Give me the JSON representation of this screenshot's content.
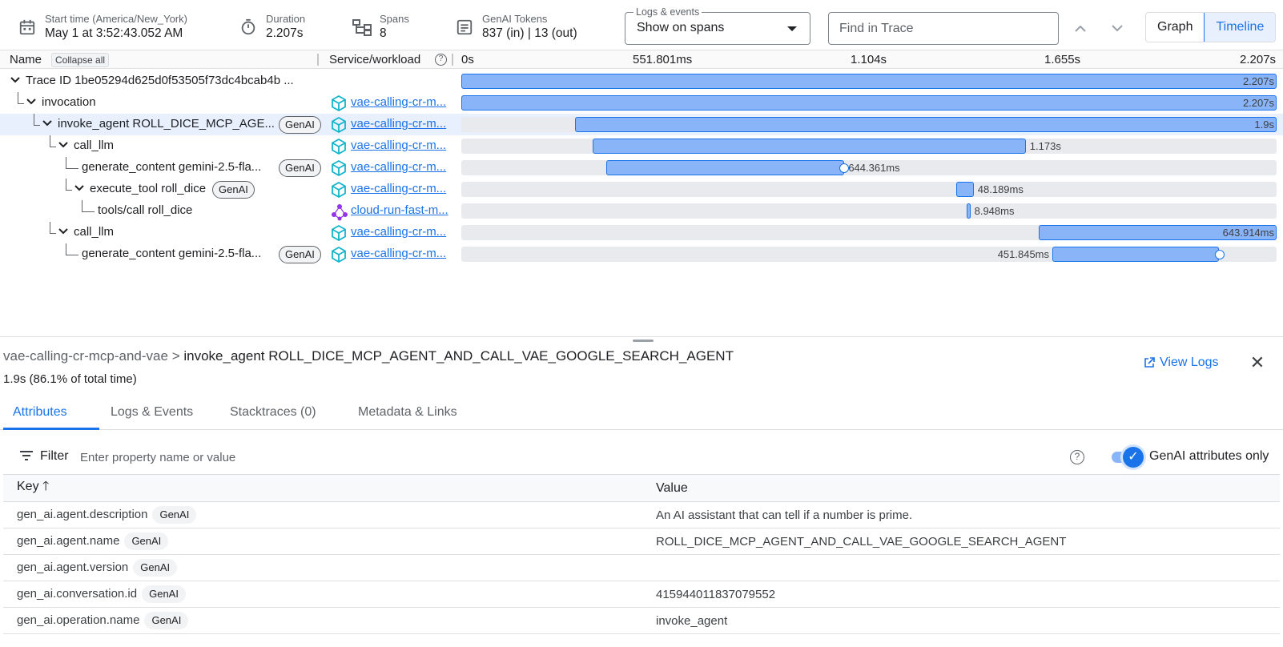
{
  "header": {
    "start_label": "Start time (America/New_York)",
    "start_value": "May 1 at 3:52:43.052 AM",
    "duration_label": "Duration",
    "duration_value": "2.207s",
    "spans_label": "Spans",
    "spans_value": "8",
    "tokens_label": "GenAI Tokens",
    "tokens_value": "837 (in) | 13 (out)",
    "logs_legend": "Logs & events",
    "logs_value": "Show on spans",
    "find_placeholder": "Find in Trace",
    "view_graph": "Graph",
    "view_timeline": "Timeline"
  },
  "columns": {
    "name": "Name",
    "collapse_all": "Collapse all",
    "service": "Service/workload",
    "ticks": [
      "0s",
      "551.801ms",
      "1.104s",
      "1.655s",
      "2.207s"
    ]
  },
  "badge": "GenAI",
  "spans": [
    {
      "name": "Trace ID 1be05294d625d0f53505f73dc4bcab4b ...",
      "service": "",
      "genai": false,
      "start_s": 0.0,
      "duration_s": 2.207,
      "duration_label": "2.207s"
    },
    {
      "name": "invocation",
      "service": "vae-calling-cr-m...",
      "genai": false,
      "start_s": 0.0,
      "duration_s": 2.207,
      "duration_label": "2.207s"
    },
    {
      "name": "invoke_agent ROLL_DICE_MCP_AGE...",
      "service": "vae-calling-cr-m...",
      "genai": true,
      "start_s": 0.307,
      "duration_s": 1.9,
      "duration_label": "1.9s"
    },
    {
      "name": "call_llm",
      "service": "vae-calling-cr-m...",
      "genai": false,
      "start_s": 0.355,
      "duration_s": 1.173,
      "duration_label": "1.173s"
    },
    {
      "name": "generate_content gemini-2.5-fla...",
      "service": "vae-calling-cr-m...",
      "genai": true,
      "start_s": 0.393,
      "duration_s": 0.644,
      "duration_label": "644.361ms"
    },
    {
      "name": "execute_tool roll_dice",
      "service": "vae-calling-cr-m...",
      "genai": true,
      "start_s": 1.339,
      "duration_s": 0.048,
      "duration_label": "48.189ms"
    },
    {
      "name": "tools/call roll_dice",
      "service": "cloud-run-fast-m...",
      "genai": false,
      "start_s": 1.369,
      "duration_s": 0.009,
      "duration_label": "8.948ms"
    },
    {
      "name": "call_llm",
      "service": "vae-calling-cr-m...",
      "genai": false,
      "start_s": 1.563,
      "duration_s": 0.644,
      "duration_label": "643.914ms"
    },
    {
      "name": "generate_content gemini-2.5-fla...",
      "service": "vae-calling-cr-m...",
      "genai": true,
      "start_s": 1.6,
      "duration_s": 0.452,
      "duration_label": "451.845ms"
    }
  ],
  "details": {
    "service": "vae-calling-cr-mcp-and-vae",
    "separator": ">",
    "span_name": "invoke_agent ROLL_DICE_MCP_AGENT_AND_CALL_VAE_GOOGLE_SEARCH_AGENT",
    "duration": "1.9s",
    "percent": "(86.1% of total time)",
    "view_logs": "View Logs",
    "tabs": [
      "Attributes",
      "Logs & Events",
      "Stacktraces (0)",
      "Metadata & Links"
    ],
    "filter_label": "Filter",
    "filter_placeholder": "Enter property name or value",
    "genai_only_label": "GenAI attributes only",
    "key_header": "Key",
    "value_header": "Value",
    "attributes": [
      {
        "key": "gen_ai.agent.description",
        "value": "An AI assistant that can tell if a number is prime."
      },
      {
        "key": "gen_ai.agent.name",
        "value": "ROLL_DICE_MCP_AGENT_AND_CALL_VAE_GOOGLE_SEARCH_AGENT"
      },
      {
        "key": "gen_ai.agent.version",
        "value": ""
      },
      {
        "key": "gen_ai.conversation.id",
        "value": "415944011837079552"
      },
      {
        "key": "gen_ai.operation.name",
        "value": "invoke_agent"
      }
    ]
  },
  "colors": {
    "accent": "#1a73e8",
    "bar_fill": "#8ab4f8",
    "selected_row": "#e8f0fe",
    "service_cube": "#12b5cb",
    "service_mesh": "#9334e6"
  }
}
